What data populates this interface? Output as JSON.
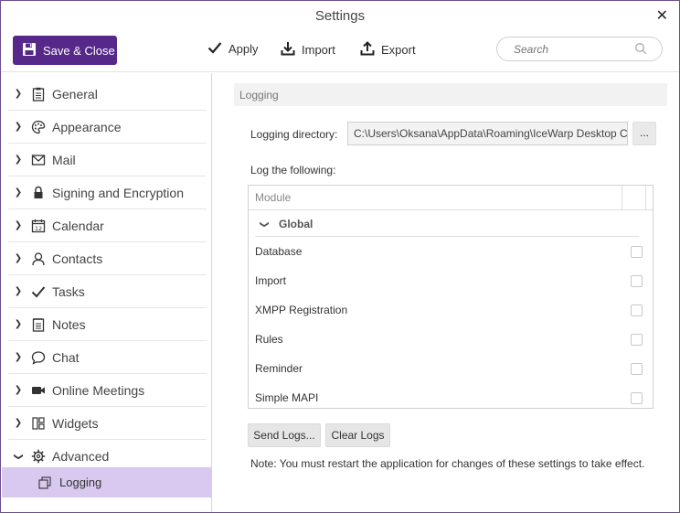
{
  "window": {
    "title": "Settings"
  },
  "toolbar": {
    "save_close": "Save & Close",
    "apply": "Apply",
    "import": "Import",
    "export": "Export",
    "search_placeholder": "Search"
  },
  "sidebar": {
    "items": [
      {
        "label": "General",
        "icon": "clipboard-icon"
      },
      {
        "label": "Appearance",
        "icon": "palette-icon"
      },
      {
        "label": "Mail",
        "icon": "envelope-icon"
      },
      {
        "label": "Signing and Encryption",
        "icon": "lock-icon"
      },
      {
        "label": "Calendar",
        "icon": "calendar-icon"
      },
      {
        "label": "Contacts",
        "icon": "person-icon"
      },
      {
        "label": "Tasks",
        "icon": "checkmark-icon"
      },
      {
        "label": "Notes",
        "icon": "notepad-icon"
      },
      {
        "label": "Chat",
        "icon": "speech-bubble-icon"
      },
      {
        "label": "Online Meetings",
        "icon": "video-camera-icon"
      },
      {
        "label": "Widgets",
        "icon": "widgets-icon"
      },
      {
        "label": "Advanced",
        "icon": "gear-icon",
        "expanded": true
      }
    ],
    "sub_item": {
      "label": "Logging",
      "icon": "log-document-icon",
      "selected": true
    }
  },
  "main": {
    "section_title": "Logging",
    "dir_label": "Logging directory:",
    "dir_value": "C:\\Users\\Oksana\\AppData\\Roaming\\IceWarp Desktop C",
    "browse_label": "...",
    "log_following": "Log the following:",
    "table": {
      "column_header": "Module",
      "group": "Global",
      "rows": [
        "Database",
        "Import",
        "XMPP Registration",
        "Rules",
        "Reminder",
        "Simple MAPI"
      ]
    },
    "send_logs": "Send Logs...",
    "clear_logs": "Clear Logs",
    "note": "Note: You must restart the application for changes of these settings to take effect."
  },
  "colors": {
    "accent": "#55288a",
    "selected_bg": "#d9c8f0"
  }
}
